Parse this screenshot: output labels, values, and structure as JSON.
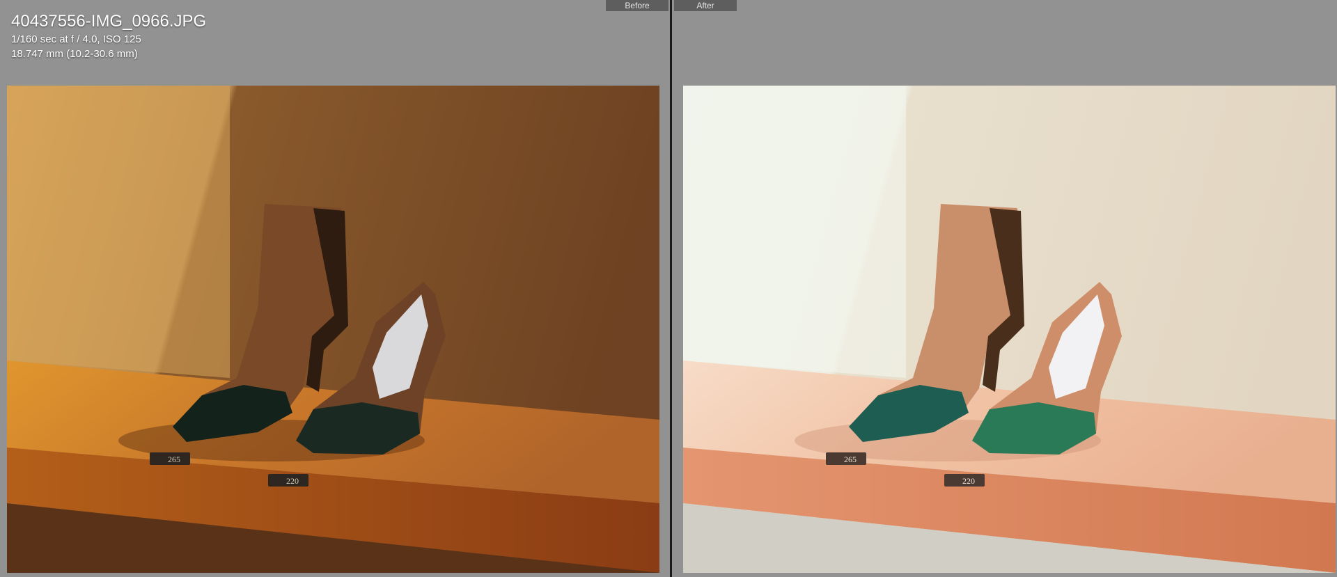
{
  "compare_view": {
    "before_label": "Before",
    "after_label": "After"
  },
  "photo_info": {
    "filename": "40437556-IMG_0966.JPG",
    "exposure": "1/160 sec at f / 4.0, ISO 125",
    "focal_length": "18.747 mm (10.2-30.6 mm)"
  },
  "price_tags": {
    "boot": "265",
    "pump": "220"
  },
  "colors": {
    "panel_bg": "#929292",
    "divider": "#1b1b1b",
    "label_bg": "#5e5e5e"
  }
}
